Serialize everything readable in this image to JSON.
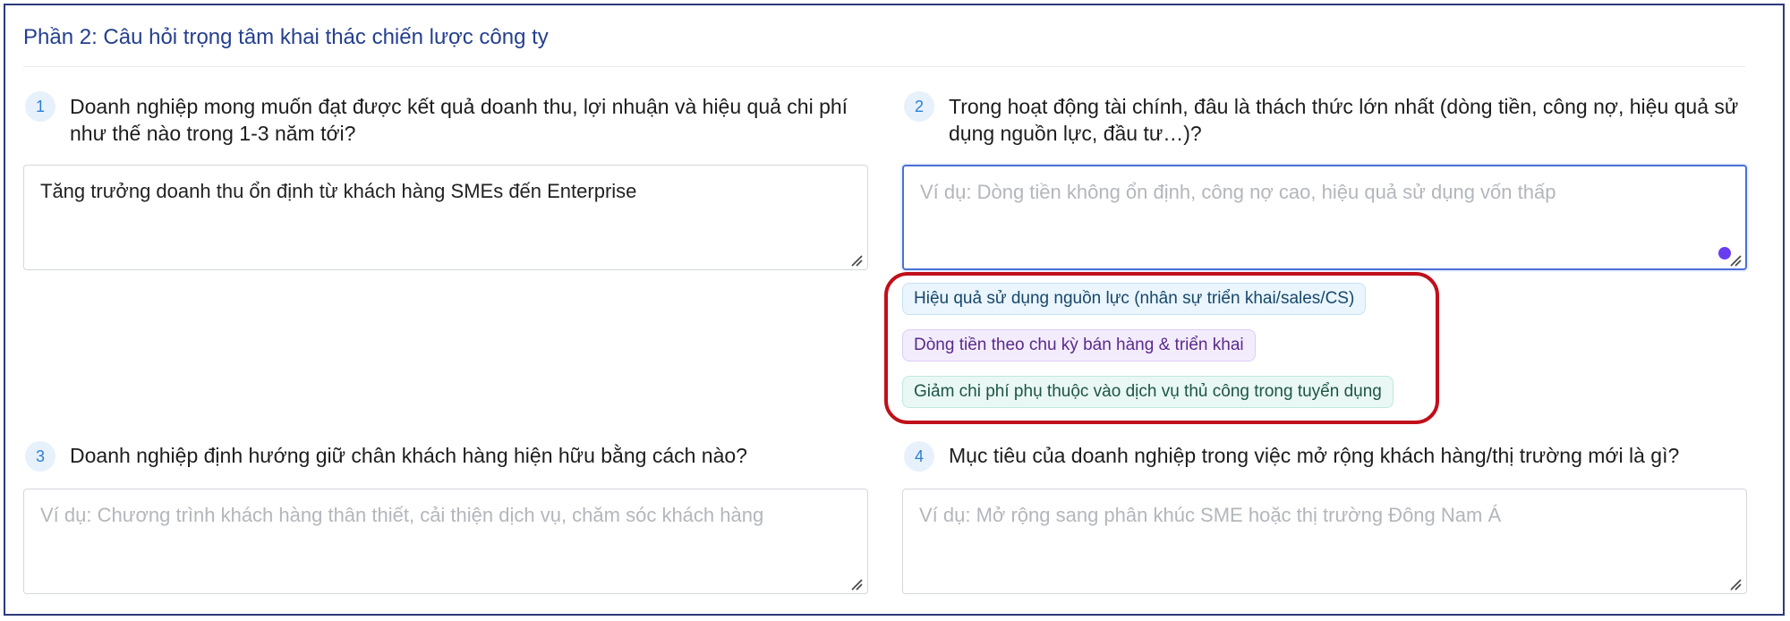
{
  "section": {
    "title": "Phần 2: Câu hỏi trọng tâm khai thác chiến lược công ty"
  },
  "questions": [
    {
      "number": "1",
      "text": "Doanh nghiệp mong muốn đạt được kết quả doanh thu, lợi nhuận và hiệu quả chi phí như thế nào trong 1-3 năm tới?",
      "value": "Tăng trưởng doanh thu ổn định từ khách hàng SMEs đến Enterprise",
      "placeholder": ""
    },
    {
      "number": "2",
      "text": "Trong hoạt động tài chính, đâu là thách thức lớn nhất (dòng tiền, công nợ, hiệu quả sử dụng nguồn lực, đầu tư…)?",
      "value": "",
      "placeholder": "Ví dụ: Dòng tiền không ổn định, công nợ cao, hiệu quả sử dụng vốn thấp"
    },
    {
      "number": "3",
      "text": "Doanh nghiệp định hướng giữ chân khách hàng hiện hữu bằng cách nào?",
      "value": "",
      "placeholder": "Ví dụ: Chương trình khách hàng thân thiết, cải thiện dịch vụ, chăm sóc khách hàng"
    },
    {
      "number": "4",
      "text": "Mục tiêu của doanh nghiệp trong việc mở rộng khách hàng/thị trường mới là gì?",
      "value": "",
      "placeholder": "Ví dụ: Mở rộng sang phân khúc SME hoặc thị trường Đông Nam Á"
    }
  ],
  "suggestions": [
    {
      "label": "Hiệu quả sử dụng nguồn lực (nhân sự triển khai/sales/CS)",
      "color": "#eaf5fd"
    },
    {
      "label": "Dòng tiền theo chu kỳ bán hàng & triển khai",
      "color": "#f3ecfd"
    },
    {
      "label": "Giảm chi phí phụ thuộc vào dịch vụ thủ công trong tuyển dụng",
      "color": "#e9f8f4"
    }
  ],
  "colors": {
    "accent": "#243f8f",
    "highlight_border": "#c0101a",
    "focus_border": "#4a6fd6",
    "indicator_dot": "#6a3cf0"
  },
  "icons": [
    "resize-grip-icon",
    "grammar-indicator-icon"
  ]
}
